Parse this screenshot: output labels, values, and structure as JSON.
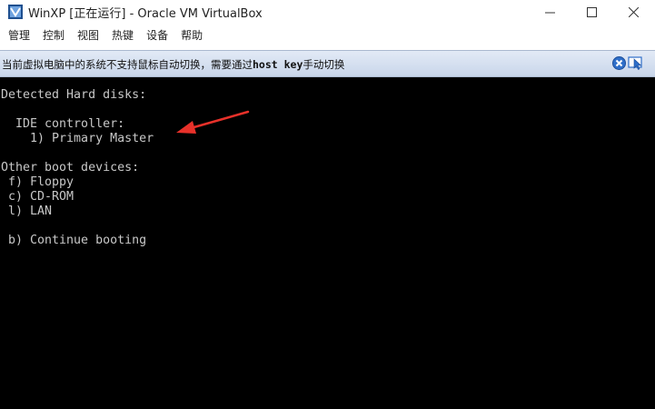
{
  "window": {
    "title": "WinXP [正在运行] - Oracle VM VirtualBox",
    "icon": "virtualbox-icon",
    "controls": [
      "minimize-icon",
      "maximize-icon",
      "close-icon"
    ]
  },
  "menu": {
    "items": [
      {
        "label": "管理"
      },
      {
        "label": "控制"
      },
      {
        "label": "视图"
      },
      {
        "label": "热键"
      },
      {
        "label": "设备"
      },
      {
        "label": "帮助"
      }
    ]
  },
  "notice": {
    "text_before": "当前虚拟电脑中的系统不支持鼠标自动切换，需要通过",
    "key": "host key",
    "text_after": "手动切换",
    "icons": [
      "close-notice-icon",
      "mouse-integration-icon"
    ]
  },
  "console": {
    "lines": [
      "Detected Hard disks:",
      "",
      "  IDE controller:",
      "    1) Primary Master",
      "",
      "Other boot devices:",
      " f) Floppy",
      " c) CD-ROM",
      " l) LAN",
      "",
      " b) Continue booting"
    ]
  },
  "annotation": {
    "icon": "red-arrow-icon",
    "color": "#e8312a"
  },
  "colors": {
    "console_bg": "#000000",
    "console_text": "#c8c8c8",
    "notice_bg": "#d6e0f0"
  }
}
